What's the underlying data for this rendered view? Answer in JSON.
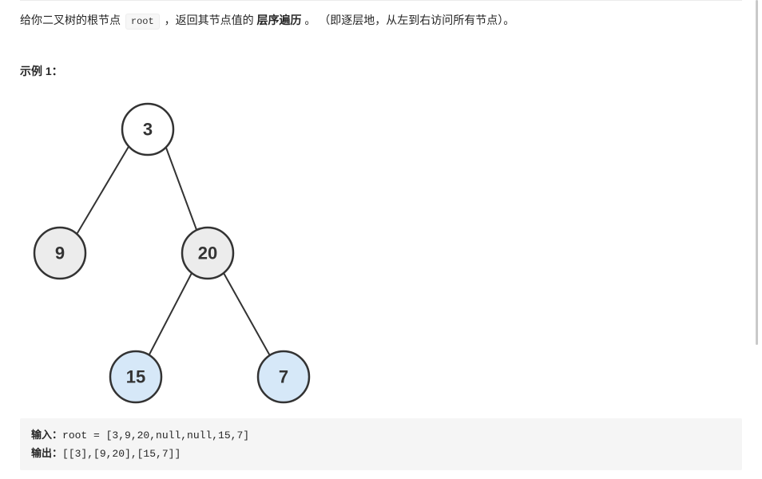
{
  "problem": {
    "prefix": "给你二叉树的根节点 ",
    "root_code": "root",
    "mid1": " ，返回其节点值的 ",
    "bold": "层序遍历",
    "mid2": " 。 （即逐层地，从左到右访问所有节点）。"
  },
  "example": {
    "label": "示例 1：",
    "input_label": "输入：",
    "input_value": "root = [3,9,20,null,null,15,7]",
    "output_label": "输出：",
    "output_value": "[[3],[9,20],[15,7]]"
  },
  "tree": {
    "nodes": {
      "n3": "3",
      "n9": "9",
      "n20": "20",
      "n15": "15",
      "n7": "7"
    }
  },
  "colors": {
    "node_white": "#ffffff",
    "node_gray": "#ececec",
    "node_blue": "#d6e8f8"
  }
}
